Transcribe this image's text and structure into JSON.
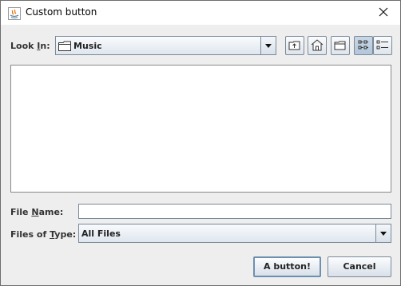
{
  "window": {
    "title": "Custom button"
  },
  "look_in": {
    "label_pre": "Look ",
    "label_mnemonic": "I",
    "label_post": "n:",
    "value": "Music"
  },
  "toolbar": {
    "up_one_level": "up-one-level-icon",
    "home": "home-icon",
    "new_folder": "new-folder-icon",
    "list_view": "list-view-icon",
    "details_view": "details-view-icon"
  },
  "file_name": {
    "label_pre": "File ",
    "label_mnemonic": "N",
    "label_post": "ame:",
    "value": ""
  },
  "files_of_type": {
    "label_pre": "Files of ",
    "label_mnemonic": "T",
    "label_post": "ype:",
    "value": "All Files"
  },
  "buttons": {
    "custom": "A button!",
    "cancel": "Cancel"
  }
}
